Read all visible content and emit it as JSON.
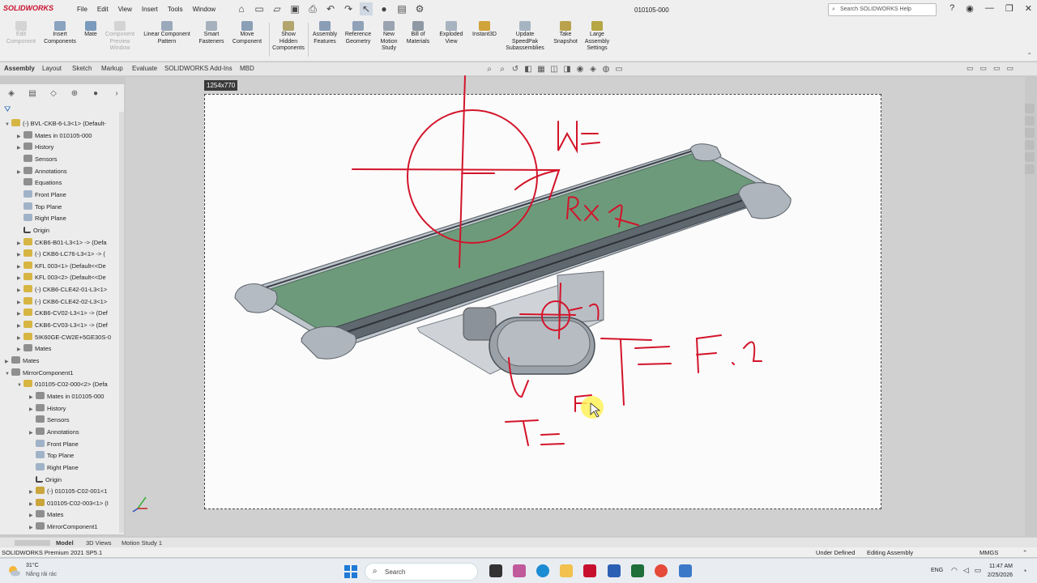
{
  "app": {
    "logo_text": "SOLIDWORKS",
    "document_title": "010105-000",
    "menu": [
      "File",
      "Edit",
      "View",
      "Insert",
      "Tools",
      "Window"
    ],
    "search_placeholder": "Search SOLIDWORKS Help"
  },
  "commands": [
    {
      "label": "Edit\nComponent",
      "disabled": true
    },
    {
      "label": "Insert\nComponents",
      "disabled": false
    },
    {
      "label": "Mate",
      "disabled": false
    },
    {
      "label": "Component\nPreview\nWindow",
      "disabled": true
    },
    {
      "label": "Linear Component\nPattern",
      "disabled": false
    },
    {
      "label": "Smart\nFasteners",
      "disabled": false
    },
    {
      "label": "Move\nComponent",
      "disabled": false
    },
    {
      "label": "Show\nHidden\nComponents",
      "disabled": false
    },
    {
      "label": "Assembly\nFeatures",
      "disabled": false
    },
    {
      "label": "Reference\nGeometry",
      "disabled": false
    },
    {
      "label": "New\nMotion\nStudy",
      "disabled": false
    },
    {
      "label": "Bill of\nMaterials",
      "disabled": false
    },
    {
      "label": "Exploded\nView",
      "disabled": false
    },
    {
      "label": "Instant3D",
      "disabled": false
    },
    {
      "label": "Update\nSpeedPak\nSubassemblies",
      "disabled": false
    },
    {
      "label": "Take\nSnapshot",
      "disabled": false
    },
    {
      "label": "Large\nAssembly\nSettings",
      "disabled": false
    }
  ],
  "tabs": [
    "Assembly",
    "Layout",
    "Sketch",
    "Markup",
    "Evaluate",
    "SOLIDWORKS Add-Ins",
    "MBD"
  ],
  "active_tab": "Assembly",
  "tree": [
    {
      "text": "(-) BVL-CKB-6-L3<1> (Default-",
      "icon": "asm",
      "indent": 0,
      "toggle": "open"
    },
    {
      "text": "Mates in 010105-000",
      "icon": "folder",
      "indent": 1,
      "toggle": "closed"
    },
    {
      "text": "History",
      "icon": "folder",
      "indent": 1,
      "toggle": "closed"
    },
    {
      "text": "Sensors",
      "icon": "folder",
      "indent": 1,
      "toggle": ""
    },
    {
      "text": "Annotations",
      "icon": "folder",
      "indent": 1,
      "toggle": "closed"
    },
    {
      "text": "Equations",
      "icon": "folder",
      "indent": 1,
      "toggle": ""
    },
    {
      "text": "Front Plane",
      "icon": "plane",
      "indent": 1,
      "toggle": ""
    },
    {
      "text": "Top Plane",
      "icon": "plane",
      "indent": 1,
      "toggle": ""
    },
    {
      "text": "Right Plane",
      "icon": "plane",
      "indent": 1,
      "toggle": ""
    },
    {
      "text": "Origin",
      "icon": "origin",
      "indent": 1,
      "toggle": ""
    },
    {
      "text": "CKB6-B01-L3<1> -> (Defa",
      "icon": "asm",
      "indent": 1,
      "toggle": "closed"
    },
    {
      "text": "(-) CKB6-LC76-L3<1> -> (",
      "icon": "asm",
      "indent": 1,
      "toggle": "closed"
    },
    {
      "text": "KFL 003<1> (Default<<De",
      "icon": "asm",
      "indent": 1,
      "toggle": "closed"
    },
    {
      "text": "KFL 003<2> (Default<<De",
      "icon": "asm",
      "indent": 1,
      "toggle": "closed"
    },
    {
      "text": "(-) CKB6-CLE42-01-L3<1>",
      "icon": "asm",
      "indent": 1,
      "toggle": "closed"
    },
    {
      "text": "(-) CKB6-CLE42-02-L3<1>",
      "icon": "asm",
      "indent": 1,
      "toggle": "closed"
    },
    {
      "text": "CKB6-CV02-L3<1> -> (Def",
      "icon": "asm",
      "indent": 1,
      "toggle": "closed"
    },
    {
      "text": "CKB6-CV03-L3<1> -> (Def",
      "icon": "asm",
      "indent": 1,
      "toggle": "closed"
    },
    {
      "text": "5IK60GE-CW2E+5GE30S-0",
      "icon": "asm",
      "indent": 1,
      "toggle": "closed"
    },
    {
      "text": "Mates",
      "icon": "folder",
      "indent": 1,
      "toggle": "closed"
    },
    {
      "text": "Mates",
      "icon": "folder",
      "indent": 0,
      "toggle": "closed"
    },
    {
      "text": "MirrorComponent1",
      "icon": "folder",
      "indent": 0,
      "toggle": "open"
    },
    {
      "text": "010105-C02-000<2> (Defa",
      "icon": "asm",
      "indent": 1,
      "toggle": "open"
    },
    {
      "text": "Mates in 010105-000",
      "icon": "folder",
      "indent": 2,
      "toggle": "closed"
    },
    {
      "text": "History",
      "icon": "folder",
      "indent": 2,
      "toggle": "closed"
    },
    {
      "text": "Sensors",
      "icon": "folder",
      "indent": 2,
      "toggle": ""
    },
    {
      "text": "Annotations",
      "icon": "folder",
      "indent": 2,
      "toggle": "closed"
    },
    {
      "text": "Front Plane",
      "icon": "plane",
      "indent": 2,
      "toggle": ""
    },
    {
      "text": "Top Plane",
      "icon": "plane",
      "indent": 2,
      "toggle": ""
    },
    {
      "text": "Right Plane",
      "icon": "plane",
      "indent": 2,
      "toggle": ""
    },
    {
      "text": "Origin",
      "icon": "origin",
      "indent": 2,
      "toggle": ""
    },
    {
      "text": "(-) 010105-C02-001<1",
      "icon": "part",
      "indent": 2,
      "toggle": "closed"
    },
    {
      "text": "010105-C02-003<1> (I",
      "icon": "part",
      "indent": 2,
      "toggle": "closed"
    },
    {
      "text": "Mates",
      "icon": "folder",
      "indent": 2,
      "toggle": "closed"
    },
    {
      "text": "MirrorComponent1",
      "icon": "folder",
      "indent": 2,
      "toggle": "closed"
    }
  ],
  "viewport": {
    "recording_size_label": "1254x770",
    "annotations": [
      "M=",
      "Rx1",
      "1",
      "T=F.1",
      "T=",
      "F"
    ]
  },
  "bottom_tabs": [
    "Model",
    "3D Views",
    "Motion Study 1"
  ],
  "status": {
    "product": "SOLIDWORKS Premium 2021 SP5.1",
    "state": "Under Defined",
    "mode": "Editing Assembly",
    "units": "MMGS"
  },
  "taskbar": {
    "weather_temp": "31°C",
    "weather_desc": "Nắng rải rác",
    "search_label": "Search",
    "lang": "ENG",
    "time": "11:47 AM",
    "date": "2/25/2026"
  },
  "colors": {
    "accent_red": "#d3142a",
    "belt_green": "#6e9a7c",
    "frame_gray": "#9aa3ad"
  }
}
